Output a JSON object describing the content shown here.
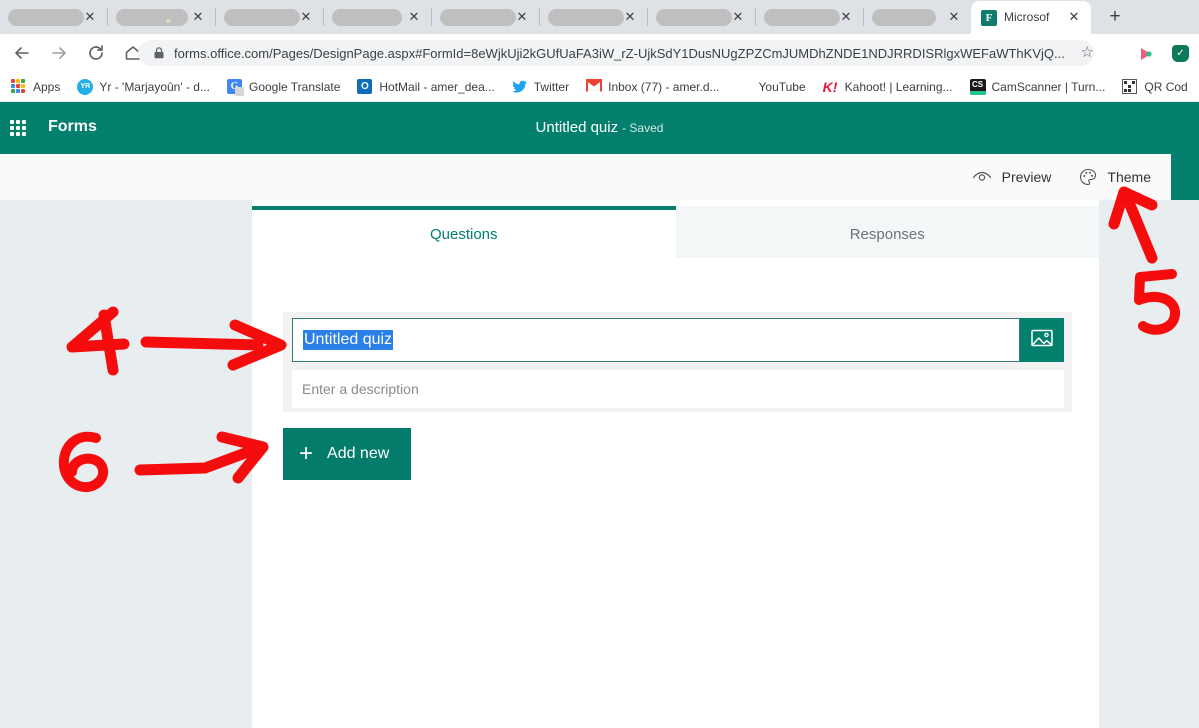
{
  "browser": {
    "tabs": [
      {
        "label": "",
        "redacted": true,
        "active": false
      },
      {
        "label": "",
        "redacted": true,
        "active": false
      },
      {
        "label": "",
        "redacted": true,
        "active": false
      },
      {
        "label": "",
        "redacted": true,
        "active": false
      },
      {
        "label": "",
        "redacted": true,
        "active": false
      },
      {
        "label": "",
        "redacted": true,
        "active": false
      },
      {
        "label": "",
        "redacted": true,
        "active": false
      },
      {
        "label": "",
        "redacted": true,
        "active": false
      },
      {
        "label": "",
        "redacted": true,
        "active": false
      },
      {
        "label": "Microsof",
        "redacted": false,
        "active": true
      }
    ],
    "new_tab_label": "+",
    "close_glyph": "✕",
    "nav": {
      "back": "←",
      "forward": "→",
      "reload": "⟳",
      "home": "⌂"
    },
    "omnibox": {
      "lock_icon": "lock-icon",
      "url": "forms.office.com/Pages/DesignPage.aspx#FormId=8eWjkUji2kGUfUaFA3iW_rZ-UjkSdY1DusNUgZPZCmJUMDhZNDE1NDJRRDISRlgxWEFaWThKVjQ...",
      "star_glyph": "☆"
    },
    "bookmarks": [
      {
        "label": "Apps",
        "icon": "apps-grid-icon"
      },
      {
        "label": "Yr - 'Marjayoûn' - d...",
        "icon": "yr-weather-icon"
      },
      {
        "label": "Google Translate",
        "icon": "google-translate-icon"
      },
      {
        "label": "HotMail - amer_dea...",
        "icon": "outlook-icon"
      },
      {
        "label": "Twitter",
        "icon": "twitter-icon"
      },
      {
        "label": "Inbox (77) - amer.d...",
        "icon": "gmail-icon"
      },
      {
        "label": "YouTube",
        "icon": "youtube-icon"
      },
      {
        "label": "Kahoot! | Learning...",
        "icon": "kahoot-icon"
      },
      {
        "label": "CamScanner | Turn...",
        "icon": "camscanner-icon"
      },
      {
        "label": "QR Cod",
        "icon": "qr-code-icon"
      }
    ]
  },
  "forms": {
    "brand": "Forms",
    "waffle_icon": "app-launcher-icon",
    "form_title": "Untitled quiz",
    "save_status": "- Saved",
    "commands": [
      {
        "label": "Preview",
        "icon": "eye-icon"
      },
      {
        "label": "Theme",
        "icon": "palette-icon"
      }
    ],
    "tabs": [
      {
        "label": "Questions",
        "active": true
      },
      {
        "label": "Responses",
        "active": false
      }
    ],
    "title_field": {
      "value": "Untitled quiz",
      "selected": true
    },
    "description_field": {
      "value": "",
      "placeholder": "Enter a description"
    },
    "image_button_icon": "image-icon",
    "add_new": {
      "label": "Add new",
      "plus_glyph": "+"
    }
  },
  "annotations": [
    {
      "id": "a4",
      "text": "4",
      "arrow": "right",
      "target": "title-field"
    },
    {
      "id": "a6",
      "text": "6",
      "arrow": "right",
      "target": "add-new-button"
    },
    {
      "id": "a5",
      "text": "5",
      "arrow": "up",
      "target": "theme-accent-block"
    }
  ],
  "colors": {
    "teal": "#037f6e",
    "teal_button": "#047c6b",
    "page_bg": "#e8eef0",
    "annotation_red": "#f50d0d",
    "selection_blue": "#2a7fe8"
  }
}
